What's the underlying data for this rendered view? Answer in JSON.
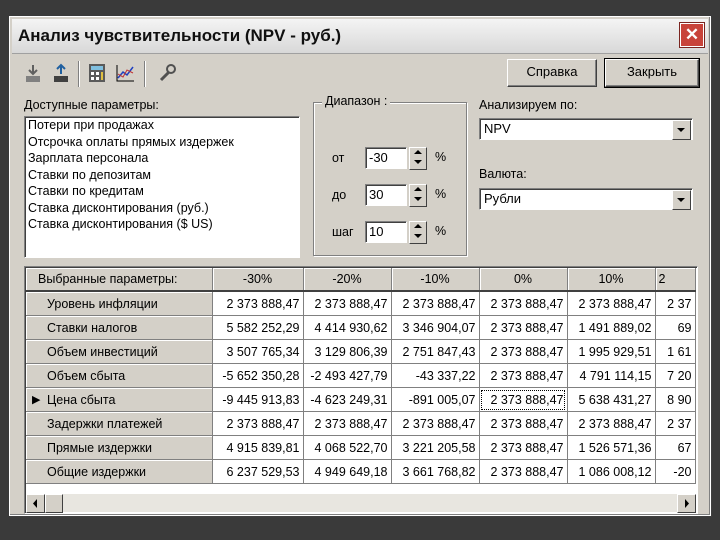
{
  "window": {
    "title": "Анализ чувствительности (NPV - руб.)"
  },
  "toolbar": {
    "icons": [
      "import-down-icon",
      "export-up-icon",
      "calculator-icon",
      "chart-icon",
      "wrench-icon"
    ],
    "help_label": "Справка",
    "close_label": "Закрыть"
  },
  "params": {
    "label": "Доступные параметры:",
    "items": [
      "Потери при продажах",
      "Отсрочка оплаты прямых издержек",
      "Зарплата персонала",
      "Ставки по депозитам",
      "Ставки по кредитам",
      "Ставка дисконтирования (руб.)",
      "Ставка дисконтирования ($ US)"
    ]
  },
  "range": {
    "label": "Диапазон :",
    "from_label": "от",
    "from_value": "-30",
    "to_label": "до",
    "to_value": "30",
    "step_label": "шаг",
    "step_value": "10",
    "unit": "%"
  },
  "analyze": {
    "label": "Анализируем по:",
    "value": "NPV"
  },
  "currency": {
    "label": "Валюта:",
    "value": "Рубли"
  },
  "grid": {
    "header": [
      "Выбранные параметры:",
      "-30%",
      "-20%",
      "-10%",
      "0%",
      "10%",
      "2"
    ],
    "rows": [
      {
        "name": "Уровень инфляции",
        "cells": [
          "2 373 888,47",
          "2 373 888,47",
          "2 373 888,47",
          "2 373 888,47",
          "2 373 888,47",
          "2 37"
        ]
      },
      {
        "name": "Ставки налогов",
        "cells": [
          "5 582 252,29",
          "4 414 930,62",
          "3 346 904,07",
          "2 373 888,47",
          "1 491 889,02",
          "69"
        ]
      },
      {
        "name": "Объем инвестиций",
        "cells": [
          "3 507 765,34",
          "3 129 806,39",
          "2 751 847,43",
          "2 373 888,47",
          "1 995 929,51",
          "1 61"
        ]
      },
      {
        "name": "Объем сбыта",
        "cells": [
          "-5 652 350,28",
          "-2 493 427,79",
          "-43 337,22",
          "2 373 888,47",
          "4 791 114,15",
          "7 20"
        ]
      },
      {
        "name": "Цена сбыта",
        "cells": [
          "-9 445 913,83",
          "-4 623 249,31",
          "-891 005,07",
          "2 373 888,47",
          "5 638 431,27",
          "8 90"
        ]
      },
      {
        "name": "Задержки платежей",
        "cells": [
          "2 373 888,47",
          "2 373 888,47",
          "2 373 888,47",
          "2 373 888,47",
          "2 373 888,47",
          "2 37"
        ]
      },
      {
        "name": "Прямые издержки",
        "cells": [
          "4 915 839,81",
          "4 068 522,70",
          "3 221 205,58",
          "2 373 888,47",
          "1 526 571,36",
          "67"
        ]
      },
      {
        "name": "Общие издержки",
        "cells": [
          "6 237 529,53",
          "4 949 649,18",
          "3 661 768,82",
          "2 373 888,47",
          "1 086 008,12",
          "-20"
        ]
      }
    ],
    "current_row_marker": "▶",
    "current_row": 4
  }
}
